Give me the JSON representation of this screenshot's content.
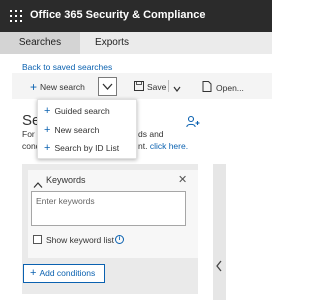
{
  "app": {
    "title": "Office 365 Security & Compliance"
  },
  "tabs": [
    {
      "label": "Searches",
      "active": true
    },
    {
      "label": "Exports",
      "active": false
    }
  ],
  "back_link": "Back to saved searches",
  "toolbar": {
    "new_search_label": "New search",
    "save_label": "Save",
    "open_label": "Open..."
  },
  "dropdown": {
    "items": [
      "Guided search",
      "New search",
      "Search by ID List"
    ]
  },
  "page": {
    "heading": "Sea",
    "intro_line1": "For t",
    "intro_line2": "cond",
    "intro_right1": "ds and",
    "intro_right2_prefix": "nt. ",
    "intro_right2_link": "click here."
  },
  "keywords": {
    "title": "Keywords",
    "input_placeholder": "Enter keywords",
    "show_list_label": "Show keyword list",
    "show_list_checked": false
  },
  "add_conditions_label": "Add conditions",
  "colors": {
    "accent": "#0a61b0",
    "topbar": "#2b2b2b"
  }
}
